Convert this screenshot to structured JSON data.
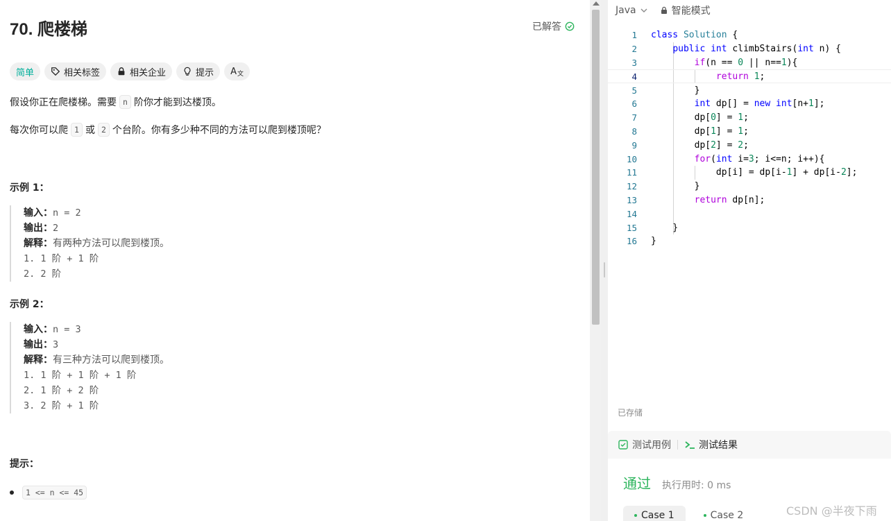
{
  "problem": {
    "title": "70. 爬楼梯",
    "solved_label": "已解答",
    "tags": [
      {
        "label": "简单",
        "icon": "none"
      },
      {
        "label": "相关标签",
        "icon": "tag-icon"
      },
      {
        "label": "相关企业",
        "icon": "lock-icon"
      },
      {
        "label": "提示",
        "icon": "bulb-icon"
      },
      {
        "label": "A",
        "icon": "translate-icon"
      }
    ],
    "desc1": {
      "before": "假设你正在爬楼梯。需要",
      "code": "n",
      "after": "阶你才能到达楼顶。"
    },
    "desc2": {
      "before": "每次你可以爬",
      "code1": "1",
      "mid": "或",
      "code2": "2",
      "after": "个台阶。你有多少种不同的方法可以爬到楼顶呢？"
    },
    "example1": {
      "heading": "示例 1：",
      "input_label": "输入：",
      "input": "n = 2",
      "output_label": "输出：",
      "output": "2",
      "explain_label": "解释：",
      "explain": "有两种方法可以爬到楼顶。",
      "steps": [
        "1. 1 阶 + 1 阶",
        "2. 2 阶"
      ]
    },
    "example2": {
      "heading": "示例 2：",
      "input_label": "输入：",
      "input": "n = 3",
      "output_label": "输出：",
      "output": "3",
      "explain_label": "解释：",
      "explain": "有三种方法可以爬到楼顶。",
      "steps": [
        "1. 1 阶 + 1 阶 + 1 阶",
        "2. 1 阶 + 2 阶",
        "3. 2 阶 + 1 阶"
      ]
    },
    "hints_heading": "提示：",
    "constraint": "1 <= n <= 45"
  },
  "editor": {
    "language": "Java",
    "mode": "智能模式",
    "saved": "已存储",
    "lines": [
      "1",
      "2",
      "3",
      "4",
      "5",
      "6",
      "7",
      "8",
      "9",
      "10",
      "11",
      "12",
      "13",
      "14",
      "15",
      "16"
    ]
  },
  "bottom": {
    "tab_testcase": "测试用例",
    "tab_result": "测试结果",
    "status": "通过",
    "runtime": "执行用时: 0 ms",
    "cases": [
      "Case 1",
      "Case 2"
    ]
  },
  "watermark": "CSDN @半夜下雨",
  "colors": {
    "accent": "#2db55d",
    "easy": "#00af9b"
  }
}
